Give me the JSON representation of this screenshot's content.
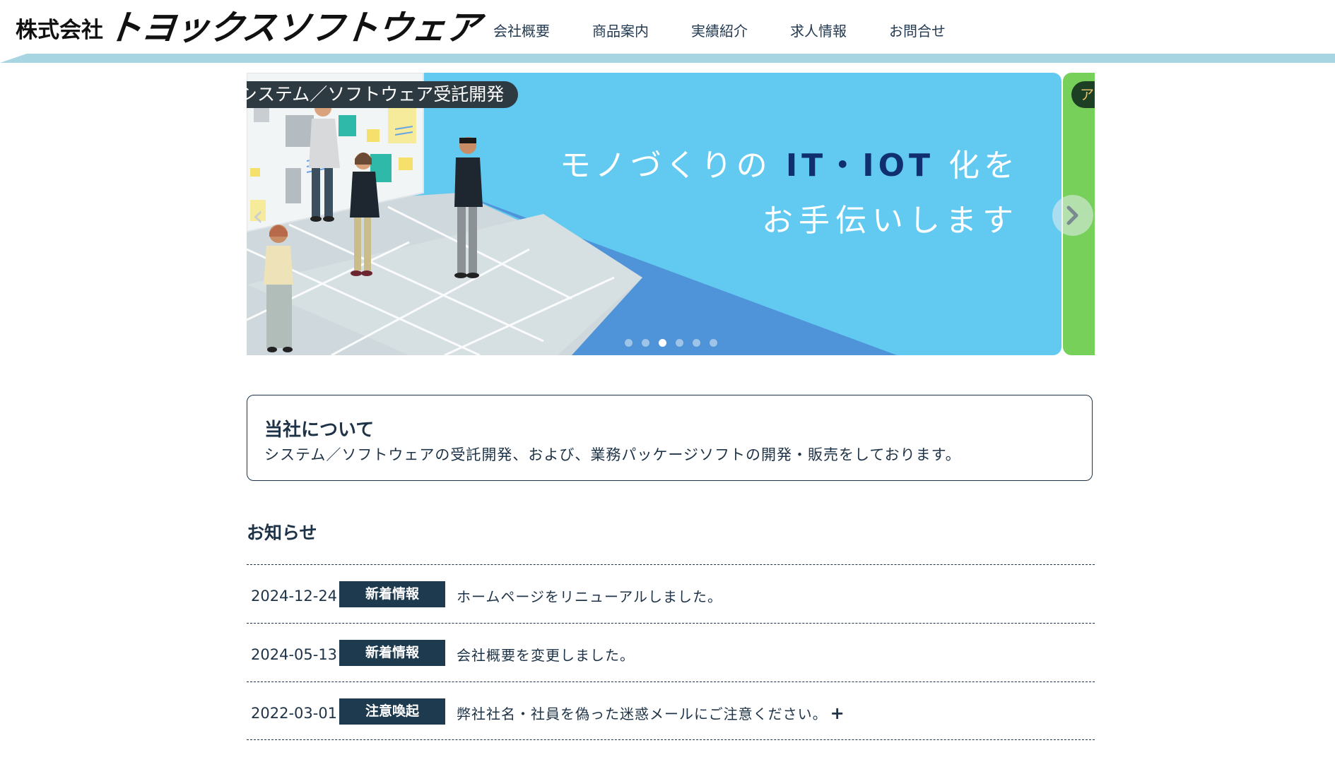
{
  "header": {
    "logo_prefix": "株式会社",
    "logo_main": "トヨックスソフトウェア",
    "nav": [
      "会社概要",
      "商品案内",
      "実績紹介",
      "求人情報",
      "お問合せ"
    ]
  },
  "carousel": {
    "badge": "システム／ソフトウェア受託開発",
    "tagline_part1": "モノづくりの ",
    "tagline_highlight": "IT・IOT",
    "tagline_part2": " 化を",
    "tagline_line2": "お手伝いします",
    "next_slide_badge": "ア",
    "dots_total": 6,
    "active_dot_index": 2,
    "colors": {
      "sky": "#62c9f0",
      "floor_blue": "#4f94d8",
      "next_slide": "#76d05a"
    }
  },
  "about": {
    "title": "当社について",
    "text": "システム／ソフトウェアの受託開発、および、業務パッケージソフトの開発・販売をしております。"
  },
  "news": {
    "title": "お知らせ",
    "items": [
      {
        "date": "2024-12-24",
        "category": "新着情報",
        "text": "ホームページをリニューアルしました。",
        "expand": ""
      },
      {
        "date": "2024-05-13",
        "category": "新着情報",
        "text": "会社概要を変更しました。",
        "expand": ""
      },
      {
        "date": "2022-03-01",
        "category": "注意喚起",
        "text": "弊社社名・社員を偽った迷惑メールにご注意ください。",
        "expand": "+"
      }
    ]
  }
}
